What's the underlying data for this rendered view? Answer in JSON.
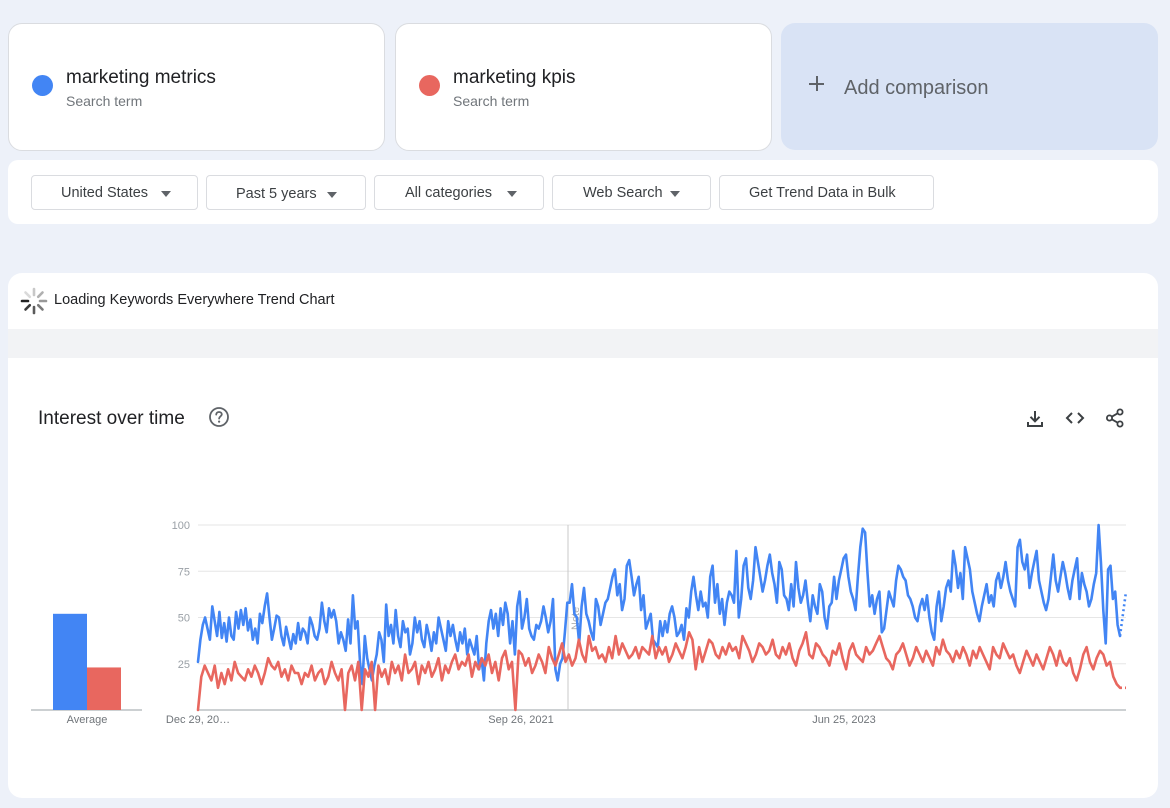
{
  "terms": [
    {
      "name": "marketing metrics",
      "subtitle": "Search term",
      "color": "#4285f4"
    },
    {
      "name": "marketing kpis",
      "subtitle": "Search term",
      "color": "#e8675f"
    }
  ],
  "add_comparison": {
    "label": "Add comparison",
    "icon": "plus-icon"
  },
  "filters": {
    "location": "United States",
    "time_range": "Past 5 years",
    "category": "All categories",
    "search_type": "Web Search",
    "bulk": "Get Trend Data in Bulk"
  },
  "keywords_everywhere": {
    "label": "Loading Keywords Everywhere Trend Chart",
    "icon": "spinner-icon"
  },
  "chart_header": {
    "title": "Interest over time",
    "icons": [
      "help-circle-icon",
      "download-icon",
      "embed-code-icon",
      "share-icon"
    ]
  },
  "chart_data": {
    "type": "line",
    "title": "Interest over time",
    "ylim": [
      0,
      100
    ],
    "y_ticks": [
      25,
      50,
      75,
      100
    ],
    "x_tick_labels": [
      "Dec 29, 20…",
      "Sep 26, 2021",
      "Jun 25, 2023"
    ],
    "annotation": "Note",
    "grid": true,
    "legend": "none",
    "average": {
      "label": "Average",
      "values": [
        {
          "name": "marketing metrics",
          "value": 52
        },
        {
          "name": "marketing kpis",
          "value": 23
        }
      ]
    },
    "weeks": 261,
    "series": [
      {
        "name": "marketing metrics",
        "color": "#4285f4",
        "values": [
          26,
          38,
          46,
          50,
          44,
          38,
          56,
          48,
          40,
          53,
          39,
          47,
          37,
          50,
          40,
          38,
          53,
          44,
          54,
          46,
          55,
          43,
          49,
          38,
          44,
          36,
          52,
          47,
          56,
          63,
          50,
          38,
          44,
          51,
          50,
          40,
          35,
          45,
          39,
          33,
          41,
          36,
          47,
          38,
          44,
          42,
          36,
          50,
          46,
          40,
          38,
          44,
          58,
          48,
          42,
          55,
          50,
          54,
          48,
          36,
          42,
          38,
          32,
          49,
          36,
          62,
          44,
          48,
          26,
          14,
          40,
          28,
          22,
          16,
          24,
          30,
          42,
          38,
          26,
          57,
          40,
          46,
          36,
          54,
          40,
          34,
          48,
          42,
          44,
          30,
          36,
          50,
          42,
          48,
          38,
          34,
          46,
          40,
          32,
          42,
          36,
          50,
          44,
          38,
          32,
          48,
          40,
          46,
          38,
          32,
          42,
          36,
          44,
          30,
          38,
          34,
          30,
          40,
          22,
          28,
          16,
          36,
          48,
          54,
          44,
          52,
          40,
          55,
          46,
          58,
          52,
          36,
          48,
          30,
          56,
          64,
          44,
          50,
          60,
          44,
          40,
          38,
          46,
          44,
          48,
          56,
          50,
          42,
          48,
          60,
          22,
          16,
          25,
          28,
          42,
          58,
          58,
          68,
          52,
          50,
          36,
          56,
          66,
          52,
          48,
          42,
          38,
          60,
          56,
          46,
          52,
          58,
          60,
          66,
          72,
          76,
          62,
          68,
          54,
          60,
          78,
          81,
          72,
          62,
          68,
          72,
          54,
          62,
          44,
          48,
          52,
          38,
          36,
          34,
          48,
          40,
          48,
          42,
          52,
          56,
          50,
          40,
          42,
          46,
          38,
          55,
          50,
          64,
          72,
          62,
          54,
          64,
          56,
          58,
          50,
          72,
          78,
          58,
          68,
          52,
          60,
          46,
          58,
          64,
          62,
          58,
          86,
          50,
          60,
          78,
          82,
          66,
          60,
          70,
          88,
          80,
          72,
          64,
          70,
          78,
          84,
          74,
          68,
          58,
          80,
          76,
          62,
          60,
          54,
          68,
          56,
          80,
          66,
          58,
          62,
          70,
          58,
          48,
          62,
          56,
          52,
          68,
          64,
          50,
          44,
          56,
          58,
          72,
          60,
          70,
          76,
          82,
          84,
          72,
          64,
          60,
          54,
          72,
          88,
          98,
          96,
          74,
          56,
          62,
          52,
          60,
          64,
          42,
          44,
          54,
          64,
          60,
          56,
          70,
          78,
          76,
          72,
          70,
          62,
          60,
          56,
          50,
          48,
          56,
          60,
          54,
          62,
          50,
          42,
          38,
          56,
          64,
          48,
          56,
          66,
          70,
          64,
          86,
          78,
          66,
          74,
          60,
          88,
          82,
          76,
          64,
          58,
          52,
          48,
          56,
          62,
          68,
          58,
          62,
          56,
          70,
          74,
          66,
          72,
          80,
          70,
          64,
          60,
          56,
          88,
          92,
          80,
          76,
          84,
          66,
          74,
          80,
          86,
          70,
          64,
          58,
          54,
          60,
          72,
          84,
          70,
          64,
          72,
          80,
          74,
          66,
          60,
          70,
          76,
          82,
          60,
          74,
          68,
          64,
          56,
          60,
          68,
          74,
          100,
          80,
          54,
          36,
          76,
          78,
          60,
          64,
          46,
          40
        ]
      },
      {
        "name": "marketing kpis",
        "color": "#e8675f",
        "values": [
          0,
          18,
          24,
          20,
          16,
          24,
          12,
          20,
          14,
          22,
          16,
          26,
          20,
          18,
          16,
          22,
          18,
          24,
          20,
          14,
          20,
          28,
          24,
          22,
          26,
          18,
          22,
          16,
          24,
          20,
          20,
          14,
          20,
          18,
          24,
          16,
          20,
          22,
          14,
          18,
          26,
          20,
          16,
          22,
          0,
          20,
          24,
          16,
          26,
          0,
          22,
          18,
          26,
          0,
          24,
          18,
          22,
          14,
          26,
          20,
          24,
          16,
          30,
          20,
          22,
          26,
          14,
          24,
          20,
          26,
          18,
          22,
          28,
          16,
          24,
          20,
          26,
          30,
          22,
          26,
          24,
          30,
          18,
          26,
          22,
          28,
          24,
          30,
          20,
          26,
          16,
          28,
          32,
          22,
          26,
          0,
          32,
          30,
          24,
          28,
          20,
          24,
          30,
          26,
          20,
          34,
          28,
          24,
          30,
          36,
          26,
          30,
          24,
          28,
          38,
          30,
          26,
          40,
          32,
          34,
          28,
          30,
          26,
          34,
          28,
          40,
          30,
          36,
          32,
          28,
          30,
          34,
          28,
          34,
          32,
          30,
          40,
          28,
          34,
          30,
          34,
          26,
          30,
          36,
          32,
          28,
          34,
          42,
          38,
          22,
          34,
          26,
          32,
          38,
          36,
          30,
          28,
          34,
          30,
          36,
          32,
          34,
          28,
          40,
          36,
          32,
          26,
          30,
          36,
          34,
          30,
          32,
          38,
          30,
          28,
          34,
          30,
          36,
          28,
          24,
          32,
          36,
          42,
          30,
          28,
          36,
          34,
          30,
          28,
          24,
          32,
          30,
          36,
          28,
          22,
          32,
          36,
          30,
          28,
          26,
          34,
          30,
          32,
          36,
          40,
          34,
          28,
          26,
          22,
          30,
          32,
          36,
          30,
          24,
          28,
          34,
          30,
          26,
          32,
          28,
          24,
          34,
          30,
          38,
          32,
          30,
          26,
          32,
          28,
          34,
          30,
          24,
          32,
          28,
          34,
          30,
          26,
          22,
          34,
          30,
          28,
          36,
          32,
          28,
          30,
          24,
          20,
          26,
          32,
          28,
          24,
          30,
          26,
          22,
          28,
          34,
          30,
          24,
          32,
          26,
          24,
          28,
          20,
          16,
          22,
          30,
          34,
          26,
          22,
          28,
          32,
          30,
          24,
          26,
          18,
          14,
          12
        ]
      }
    ]
  }
}
